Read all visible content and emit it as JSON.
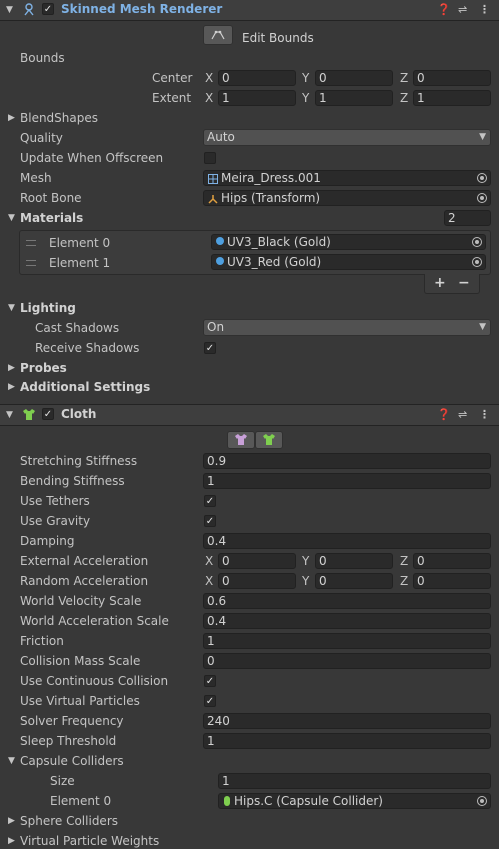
{
  "skinned": {
    "title": "Skinned Mesh Renderer",
    "edit_bounds": "Edit Bounds",
    "bounds_label": "Bounds",
    "center_label": "Center",
    "extent_label": "Extent",
    "center": {
      "x": "0",
      "y": "0",
      "z": "0"
    },
    "extent": {
      "x": "1",
      "y": "1",
      "z": "1"
    },
    "blendshapes": "BlendShapes",
    "quality_label": "Quality",
    "quality_value": "Auto",
    "update_offscreen_label": "Update When Offscreen",
    "mesh_label": "Mesh",
    "mesh_value": "Meira_Dress.001",
    "root_bone_label": "Root Bone",
    "root_bone_value": "Hips (Transform)",
    "materials_label": "Materials",
    "materials_size": "2",
    "elements": [
      {
        "label": "Element 0",
        "value": "UV3_Black (Gold)"
      },
      {
        "label": "Element 1",
        "value": "UV3_Red (Gold)"
      }
    ],
    "lighting_label": "Lighting",
    "cast_shadows_label": "Cast Shadows",
    "cast_shadows_value": "On",
    "receive_shadows_label": "Receive Shadows",
    "probes_label": "Probes",
    "additional_label": "Additional Settings"
  },
  "cloth": {
    "title": "Cloth",
    "stretching_label": "Stretching Stiffness",
    "stretching_value": "0.9",
    "bending_label": "Bending Stiffness",
    "bending_value": "1",
    "tethers_label": "Use Tethers",
    "gravity_label": "Use Gravity",
    "damping_label": "Damping",
    "damping_value": "0.4",
    "ext_acc_label": "External Acceleration",
    "ext_acc": {
      "x": "0",
      "y": "0",
      "z": "0"
    },
    "rand_acc_label": "Random Acceleration",
    "rand_acc": {
      "x": "0",
      "y": "0",
      "z": "0"
    },
    "wvs_label": "World Velocity Scale",
    "wvs_value": "0.6",
    "was_label": "World Acceleration Scale",
    "was_value": "0.4",
    "friction_label": "Friction",
    "friction_value": "1",
    "cms_label": "Collision Mass Scale",
    "cms_value": "0",
    "ucc_label": "Use Continuous Collision",
    "uvp_label": "Use Virtual Particles",
    "solver_label": "Solver Frequency",
    "solver_value": "240",
    "sleep_label": "Sleep Threshold",
    "sleep_value": "1",
    "capsule_label": "Capsule Colliders",
    "size_label": "Size",
    "size_value": "1",
    "capsule_el_label": "Element 0",
    "capsule_el_value": "Hips.C (Capsule Collider)",
    "sphere_label": "Sphere Colliders",
    "vpw_label": "Virtual Particle Weights"
  },
  "axes": {
    "x": "X",
    "y": "Y",
    "z": "Z"
  },
  "check_mark": "✓",
  "colors": {
    "accent_title": "#7fb2e5",
    "background": "#383838",
    "header": "#3e3e3e",
    "field": "#2a2a2a"
  }
}
